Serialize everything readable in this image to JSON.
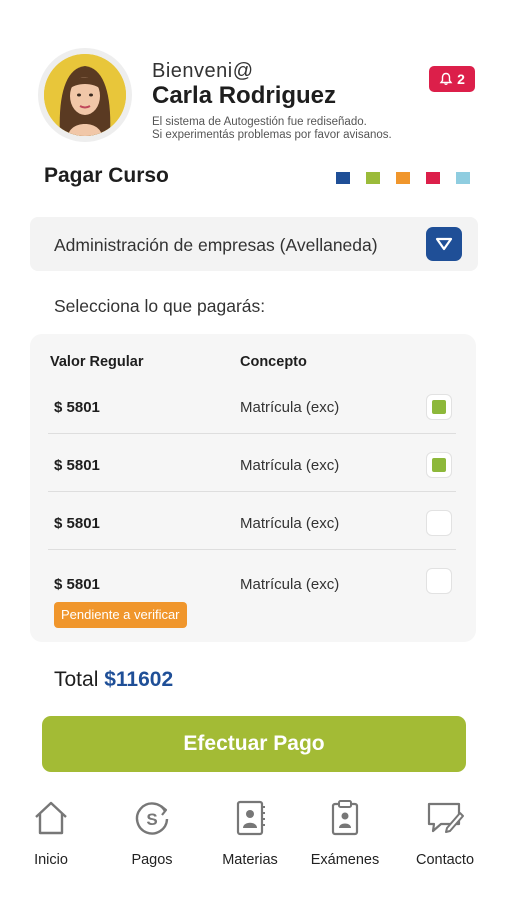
{
  "header": {
    "greeting": "Bienveni@",
    "user_name": "Carla Rodriguez",
    "notice_line1": "El sistema de  Autogestión fue  rediseñado.",
    "notice_line2": "Si experimentás problemas por favor avisanos.",
    "notifications_count": "2",
    "avatar_icon": "user-photo"
  },
  "page": {
    "title": "Pagar Curso",
    "color_dots": [
      "#1f4f97",
      "#9bbb3a",
      "#f0962c",
      "#dc1f4a",
      "#8fcde0"
    ]
  },
  "course_select": {
    "value": "Administración de empresas (Avellaneda)",
    "icon": "dropdown-icon"
  },
  "select_prompt": "Selecciona lo que pagarás:",
  "table": {
    "col_value": "Valor Regular",
    "col_concept": "Concepto",
    "rows": [
      {
        "value": "$ 5801",
        "concept": "Matrícula (exc)",
        "checked": true
      },
      {
        "value": "$ 5801",
        "concept": "Matrícula (exc)",
        "checked": true
      },
      {
        "value": "$ 5801",
        "concept": "Matrícula (exc)",
        "checked": false
      },
      {
        "value": "$ 5801",
        "concept": "Matrícula (exc)",
        "checked": false
      }
    ],
    "pending_badge": "Pendiente a verificar"
  },
  "total": {
    "label": "Total",
    "amount": "$11602"
  },
  "pay_button": "Efectuar Pago",
  "nav": {
    "items": [
      {
        "label": "Inicio",
        "icon": "home-icon"
      },
      {
        "label": "Pagos",
        "icon": "payments-icon"
      },
      {
        "label": "Materias",
        "icon": "subjects-icon"
      },
      {
        "label": "Exámenes",
        "icon": "exams-icon"
      },
      {
        "label": "Contacto",
        "icon": "contact-icon"
      }
    ]
  },
  "colors": {
    "accent_blue": "#1f4f97",
    "accent_green": "#a3bb35",
    "alert_red": "#dc1f4a",
    "pending_orange": "#f0962c"
  }
}
